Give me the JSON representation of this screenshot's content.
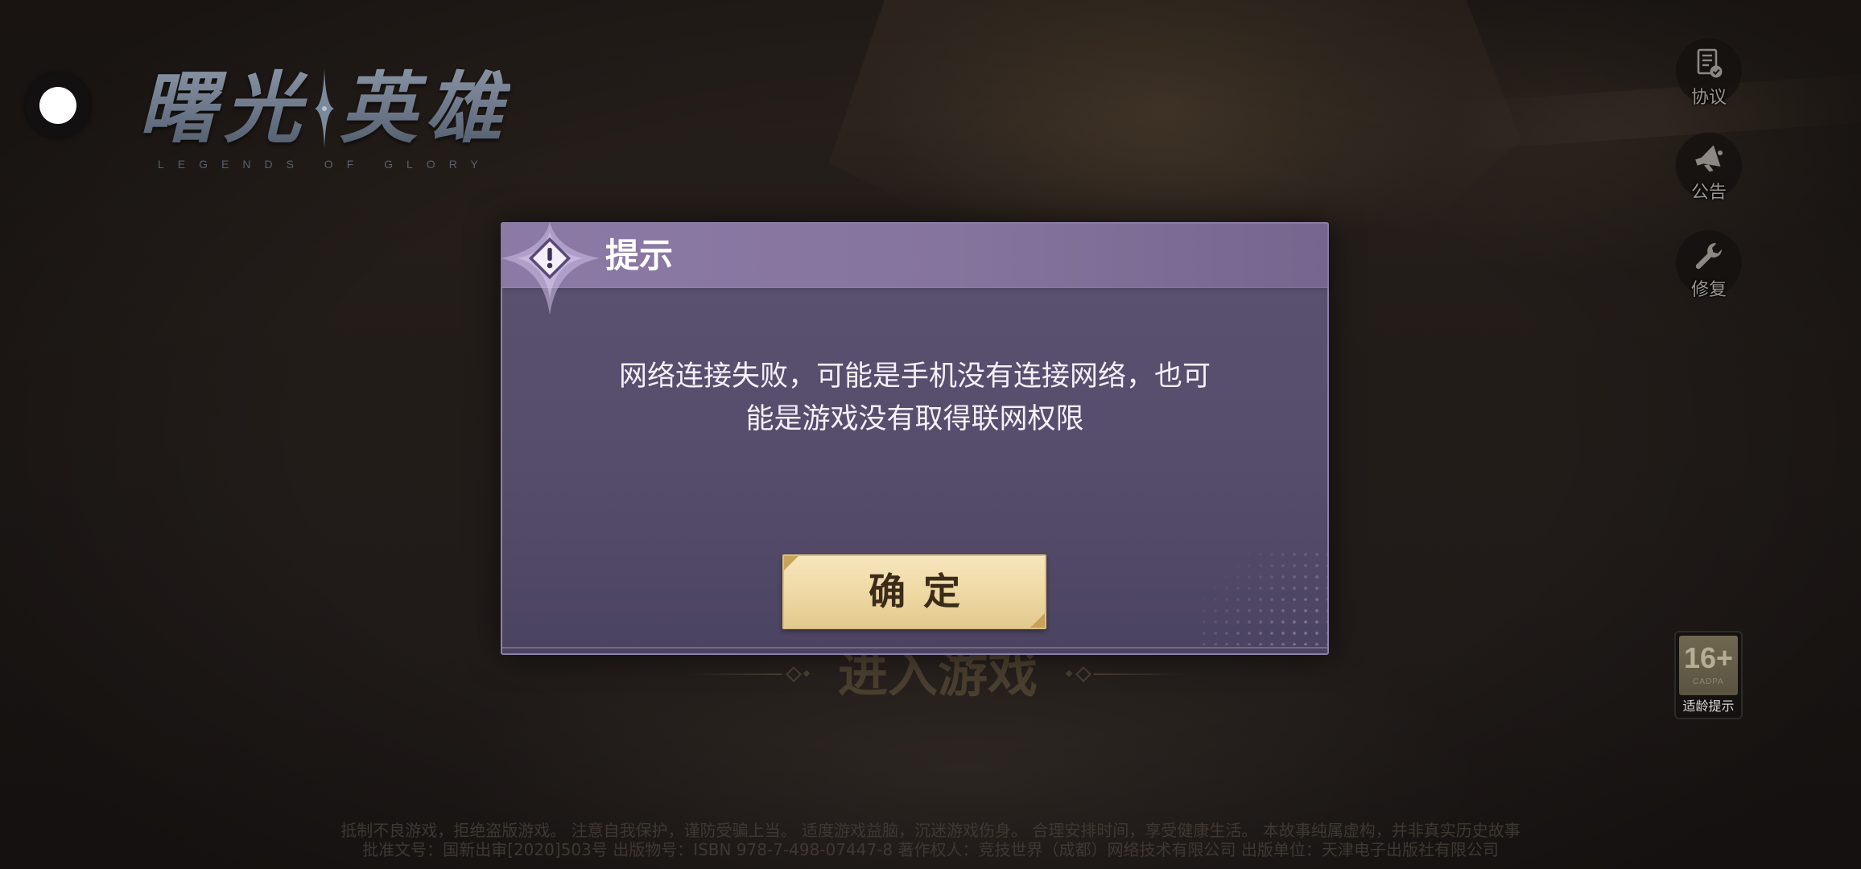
{
  "logo": {
    "title_left": "曙光",
    "title_right": "英雄",
    "subtitle": "LEGENDS OF GLORY",
    "sparkle_icon": "sparkle-icon"
  },
  "floating_button": {
    "icon": "floating-dot-icon"
  },
  "side_menu": {
    "items": [
      {
        "label": "协议",
        "icon": "agreement-icon"
      },
      {
        "label": "公告",
        "icon": "megaphone-icon"
      },
      {
        "label": "修复",
        "icon": "wrench-icon"
      }
    ]
  },
  "age_rating": {
    "age": "16+",
    "org": "CADPA",
    "label": "适龄提示"
  },
  "enter_game": {
    "label": "进入游戏"
  },
  "dialog": {
    "title": "提示",
    "icon": "warning-icon",
    "message_lines": [
      "网络连接失败，可能是手机没有连接网络，也可",
      "能是游戏没有取得联网权限"
    ],
    "confirm_label": "确定"
  },
  "footer": {
    "lines": [
      "抵制不良游戏，拒绝盗版游戏。  注意自我保护，谨防受骗上当。  适度游戏益脑，沉迷游戏伤身。  合理安排时间，享受健康生活。  本故事纯属虚构，并非真实历史故事",
      "批准文号：国新出审[2020]503号  出版物号：ISBN 978-7-498-07447-8  著作权人：竞技世界（成都）网络技术有限公司  出版单位：天津电子出版社有限公司"
    ]
  },
  "colors": {
    "dialog_header": "#85749d",
    "dialog_body": "#564d6c",
    "confirm_button": "#efd9a4",
    "confirm_text": "#3b2c1a",
    "title_text": "#ffffff"
  }
}
